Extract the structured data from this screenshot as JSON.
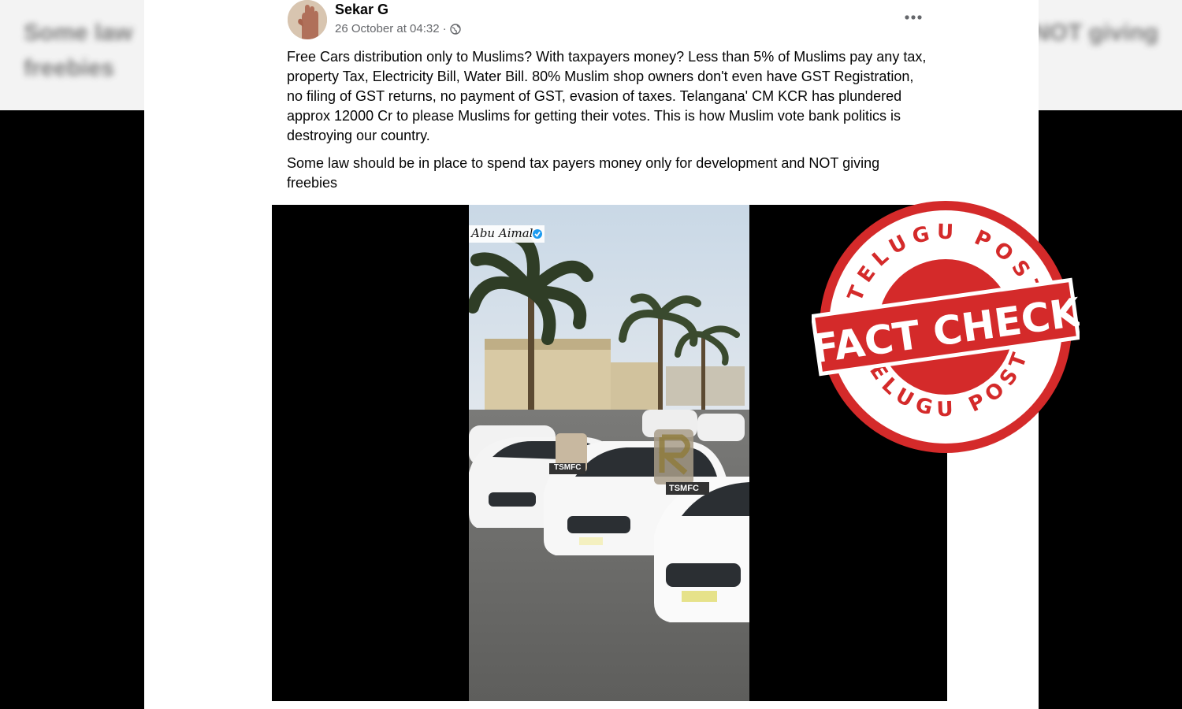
{
  "background": {
    "blur_left_1": "Some law",
    "blur_left_2": "freebies",
    "blur_right": "NOT giving"
  },
  "post": {
    "author": "Sekar G",
    "timestamp": "26 October at 04:32",
    "separator": "·",
    "privacy_icon": "globe-icon",
    "more_icon": "more-options-icon",
    "paragraph_1": "Free Cars distribution only to Muslims? With taxpayers money? Less than 5% of Muslims pay any tax, property Tax, Electricity Bill, Water Bill. 80% Muslim shop owners don't even have GST Registration,  no filing of GST returns, no payment of GST, evasion of taxes. Telangana' CM KCR has plundered approx 12000 Cr to please Muslims for getting their votes. This is how Muslim vote bank politics is destroying our country.",
    "paragraph_2": "Some law should be in place to spend tax payers money only for development and NOT giving freebies"
  },
  "photo": {
    "watermark_name": "Abu Aimal",
    "sign_1": "TSMFC",
    "sign_2": "TSMFC"
  },
  "stamp": {
    "top_arc": "TELUGU POST",
    "center": "FACT CHECK",
    "bottom_arc": "TELUGU POST",
    "color": "#d42a2a"
  }
}
